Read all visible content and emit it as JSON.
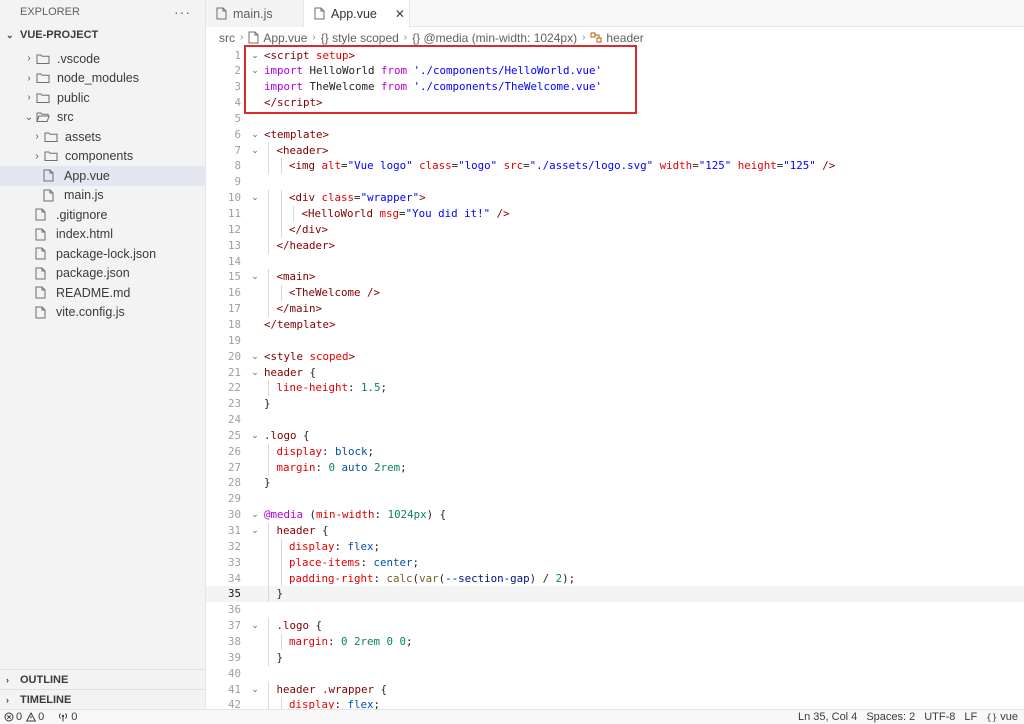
{
  "sidebar": {
    "title": "EXPLORER",
    "more": "···",
    "project": "VUE-PROJECT",
    "tree": [
      {
        "label": ".vscode",
        "type": "folder",
        "depth": 0,
        "open": false
      },
      {
        "label": "node_modules",
        "type": "folder",
        "depth": 0,
        "open": false
      },
      {
        "label": "public",
        "type": "folder",
        "depth": 0,
        "open": false
      },
      {
        "label": "src",
        "type": "folder",
        "depth": 0,
        "open": true
      },
      {
        "label": "assets",
        "type": "folder",
        "depth": 1,
        "open": false
      },
      {
        "label": "components",
        "type": "folder",
        "depth": 1,
        "open": false
      },
      {
        "label": "App.vue",
        "type": "file",
        "depth": 1,
        "selected": true
      },
      {
        "label": "main.js",
        "type": "file",
        "depth": 1
      },
      {
        "label": ".gitignore",
        "type": "file",
        "depth": 0
      },
      {
        "label": "index.html",
        "type": "file",
        "depth": 0
      },
      {
        "label": "package-lock.json",
        "type": "file",
        "depth": 0
      },
      {
        "label": "package.json",
        "type": "file",
        "depth": 0
      },
      {
        "label": "README.md",
        "type": "file",
        "depth": 0
      },
      {
        "label": "vite.config.js",
        "type": "file",
        "depth": 0
      }
    ],
    "outline": "OUTLINE",
    "timeline": "TIMELINE"
  },
  "tabs": [
    {
      "label": "main.js",
      "active": false,
      "icon": "file-icon"
    },
    {
      "label": "App.vue",
      "active": true,
      "icon": "file-icon",
      "close": "✕"
    }
  ],
  "breadcrumb": [
    "src",
    "App.vue",
    "{} style scoped",
    "{} @media (min-width: 1024px)",
    "header"
  ],
  "editor": {
    "current_line": 35,
    "lines": [
      {
        "n": 1,
        "fold": "⌄",
        "indent": 0,
        "tokens": [
          [
            "t-pun",
            "<"
          ],
          [
            "t-tag",
            "script"
          ],
          [
            "t-attr",
            " setup"
          ],
          [
            "t-pun",
            ">"
          ]
        ]
      },
      {
        "n": 2,
        "fold": "⌄",
        "indent": 0,
        "tokens": [
          [
            "t-kw",
            "import"
          ],
          [
            "t-plain",
            " HelloWorld "
          ],
          [
            "t-kw",
            "from"
          ],
          [
            "t-str",
            " './components/HelloWorld.vue'"
          ]
        ]
      },
      {
        "n": 3,
        "fold": "",
        "indent": 0,
        "tokens": [
          [
            "t-kw",
            "import"
          ],
          [
            "t-plain",
            " TheWelcome "
          ],
          [
            "t-kw",
            "from"
          ],
          [
            "t-str",
            " './components/TheWelcome.vue'"
          ]
        ]
      },
      {
        "n": 4,
        "fold": "",
        "indent": 0,
        "tokens": [
          [
            "t-pun",
            "</"
          ],
          [
            "t-tag",
            "script"
          ],
          [
            "t-pun",
            ">"
          ]
        ]
      },
      {
        "n": 5,
        "fold": "",
        "indent": 0,
        "tokens": []
      },
      {
        "n": 6,
        "fold": "⌄",
        "indent": 0,
        "tokens": [
          [
            "t-pun",
            "<"
          ],
          [
            "t-tag",
            "template"
          ],
          [
            "t-pun",
            ">"
          ]
        ]
      },
      {
        "n": 7,
        "fold": "⌄",
        "indent": 1,
        "tokens": [
          [
            "t-pun",
            "<"
          ],
          [
            "t-tag",
            "header"
          ],
          [
            "t-pun",
            ">"
          ]
        ]
      },
      {
        "n": 8,
        "fold": "",
        "indent": 2,
        "tokens": [
          [
            "t-pun",
            "<"
          ],
          [
            "t-tag",
            "img"
          ],
          [
            "t-attr",
            " alt"
          ],
          [
            "t-plain",
            "="
          ],
          [
            "t-str",
            "\"Vue logo\""
          ],
          [
            "t-attr",
            " class"
          ],
          [
            "t-plain",
            "="
          ],
          [
            "t-str",
            "\"logo\""
          ],
          [
            "t-attr",
            " src"
          ],
          [
            "t-plain",
            "="
          ],
          [
            "t-str",
            "\"./assets/logo.svg\""
          ],
          [
            "t-attr",
            " width"
          ],
          [
            "t-plain",
            "="
          ],
          [
            "t-str",
            "\"125\""
          ],
          [
            "t-attr",
            " height"
          ],
          [
            "t-plain",
            "="
          ],
          [
            "t-str",
            "\"125\""
          ],
          [
            "t-pun",
            " />"
          ]
        ]
      },
      {
        "n": 9,
        "fold": "",
        "indent": 0,
        "tokens": []
      },
      {
        "n": 10,
        "fold": "⌄",
        "indent": 2,
        "tokens": [
          [
            "t-pun",
            "<"
          ],
          [
            "t-tag",
            "div"
          ],
          [
            "t-attr",
            " class"
          ],
          [
            "t-plain",
            "="
          ],
          [
            "t-str",
            "\"wrapper\""
          ],
          [
            "t-pun",
            ">"
          ]
        ]
      },
      {
        "n": 11,
        "fold": "",
        "indent": 3,
        "tokens": [
          [
            "t-pun",
            "<"
          ],
          [
            "t-tag",
            "HelloWorld"
          ],
          [
            "t-attr",
            " msg"
          ],
          [
            "t-plain",
            "="
          ],
          [
            "t-str",
            "\"You did it!\""
          ],
          [
            "t-pun",
            " />"
          ]
        ]
      },
      {
        "n": 12,
        "fold": "",
        "indent": 2,
        "tokens": [
          [
            "t-pun",
            "</"
          ],
          [
            "t-tag",
            "div"
          ],
          [
            "t-pun",
            ">"
          ]
        ]
      },
      {
        "n": 13,
        "fold": "",
        "indent": 1,
        "tokens": [
          [
            "t-pun",
            "</"
          ],
          [
            "t-tag",
            "header"
          ],
          [
            "t-pun",
            ">"
          ]
        ]
      },
      {
        "n": 14,
        "fold": "",
        "indent": 0,
        "tokens": []
      },
      {
        "n": 15,
        "fold": "⌄",
        "indent": 1,
        "tokens": [
          [
            "t-pun",
            "<"
          ],
          [
            "t-tag",
            "main"
          ],
          [
            "t-pun",
            ">"
          ]
        ]
      },
      {
        "n": 16,
        "fold": "",
        "indent": 2,
        "tokens": [
          [
            "t-pun",
            "<"
          ],
          [
            "t-tag",
            "TheWelcome"
          ],
          [
            "t-pun",
            " />"
          ]
        ]
      },
      {
        "n": 17,
        "fold": "",
        "indent": 1,
        "tokens": [
          [
            "t-pun",
            "</"
          ],
          [
            "t-tag",
            "main"
          ],
          [
            "t-pun",
            ">"
          ]
        ]
      },
      {
        "n": 18,
        "fold": "",
        "indent": 0,
        "tokens": [
          [
            "t-pun",
            "</"
          ],
          [
            "t-tag",
            "template"
          ],
          [
            "t-pun",
            ">"
          ]
        ]
      },
      {
        "n": 19,
        "fold": "",
        "indent": 0,
        "tokens": []
      },
      {
        "n": 20,
        "fold": "⌄",
        "indent": 0,
        "tokens": [
          [
            "t-pun",
            "<"
          ],
          [
            "t-tag",
            "style"
          ],
          [
            "t-attr",
            " scoped"
          ],
          [
            "t-pun",
            ">"
          ]
        ]
      },
      {
        "n": 21,
        "fold": "⌄",
        "indent": 0,
        "tokens": [
          [
            "t-sel",
            "header"
          ],
          [
            "t-plain",
            " {"
          ]
        ]
      },
      {
        "n": 22,
        "fold": "",
        "indent": 1,
        "tokens": [
          [
            "t-prop",
            "line-height"
          ],
          [
            "t-plain",
            ": "
          ],
          [
            "t-num",
            "1.5"
          ],
          [
            "t-plain",
            ";"
          ]
        ]
      },
      {
        "n": 23,
        "fold": "",
        "indent": 0,
        "tokens": [
          [
            "t-plain",
            "}"
          ]
        ]
      },
      {
        "n": 24,
        "fold": "",
        "indent": 0,
        "tokens": []
      },
      {
        "n": 25,
        "fold": "⌄",
        "indent": 0,
        "tokens": [
          [
            "t-sel",
            ".logo"
          ],
          [
            "t-plain",
            " {"
          ]
        ]
      },
      {
        "n": 26,
        "fold": "",
        "indent": 1,
        "tokens": [
          [
            "t-prop",
            "display"
          ],
          [
            "t-plain",
            ": "
          ],
          [
            "t-val",
            "block"
          ],
          [
            "t-plain",
            ";"
          ]
        ]
      },
      {
        "n": 27,
        "fold": "",
        "indent": 1,
        "tokens": [
          [
            "t-prop",
            "margin"
          ],
          [
            "t-plain",
            ": "
          ],
          [
            "t-num",
            "0"
          ],
          [
            "t-val",
            " auto "
          ],
          [
            "t-num",
            "2rem"
          ],
          [
            "t-plain",
            ";"
          ]
        ]
      },
      {
        "n": 28,
        "fold": "",
        "indent": 0,
        "tokens": [
          [
            "t-plain",
            "}"
          ]
        ]
      },
      {
        "n": 29,
        "fold": "",
        "indent": 0,
        "tokens": []
      },
      {
        "n": 30,
        "fold": "⌄",
        "indent": 0,
        "tokens": [
          [
            "t-kw",
            "@media"
          ],
          [
            "t-plain",
            " ("
          ],
          [
            "t-prop",
            "min-width"
          ],
          [
            "t-plain",
            ": "
          ],
          [
            "t-num",
            "1024px"
          ],
          [
            "t-plain",
            ") {"
          ]
        ]
      },
      {
        "n": 31,
        "fold": "⌄",
        "indent": 1,
        "tokens": [
          [
            "t-sel",
            "header"
          ],
          [
            "t-plain",
            " {"
          ]
        ]
      },
      {
        "n": 32,
        "fold": "",
        "indent": 2,
        "tokens": [
          [
            "t-prop",
            "display"
          ],
          [
            "t-plain",
            ": "
          ],
          [
            "t-val",
            "flex"
          ],
          [
            "t-plain",
            ";"
          ]
        ]
      },
      {
        "n": 33,
        "fold": "",
        "indent": 2,
        "tokens": [
          [
            "t-prop",
            "place-items"
          ],
          [
            "t-plain",
            ": "
          ],
          [
            "t-val",
            "center"
          ],
          [
            "t-plain",
            ";"
          ]
        ]
      },
      {
        "n": 34,
        "fold": "",
        "indent": 2,
        "tokens": [
          [
            "t-prop",
            "padding-right"
          ],
          [
            "t-plain",
            ": "
          ],
          [
            "t-fn",
            "calc"
          ],
          [
            "t-plain",
            "("
          ],
          [
            "t-fn",
            "var"
          ],
          [
            "t-plain",
            "("
          ],
          [
            "t-var",
            "--section-gap"
          ],
          [
            "t-plain",
            ") / "
          ],
          [
            "t-num",
            "2"
          ],
          [
            "t-plain",
            ");"
          ]
        ]
      },
      {
        "n": 35,
        "fold": "",
        "indent": 1,
        "tokens": [
          [
            "t-plain",
            "}"
          ]
        ]
      },
      {
        "n": 36,
        "fold": "",
        "indent": 0,
        "tokens": []
      },
      {
        "n": 37,
        "fold": "⌄",
        "indent": 1,
        "tokens": [
          [
            "t-sel",
            ".logo"
          ],
          [
            "t-plain",
            " {"
          ]
        ]
      },
      {
        "n": 38,
        "fold": "",
        "indent": 2,
        "tokens": [
          [
            "t-prop",
            "margin"
          ],
          [
            "t-plain",
            ": "
          ],
          [
            "t-num",
            "0 2rem 0 0"
          ],
          [
            "t-plain",
            ";"
          ]
        ]
      },
      {
        "n": 39,
        "fold": "",
        "indent": 1,
        "tokens": [
          [
            "t-plain",
            "}"
          ]
        ]
      },
      {
        "n": 40,
        "fold": "",
        "indent": 0,
        "tokens": []
      },
      {
        "n": 41,
        "fold": "⌄",
        "indent": 1,
        "tokens": [
          [
            "t-sel",
            "header .wrapper"
          ],
          [
            "t-plain",
            " {"
          ]
        ]
      },
      {
        "n": 42,
        "fold": "",
        "indent": 2,
        "tokens": [
          [
            "t-prop",
            "display"
          ],
          [
            "t-plain",
            ": "
          ],
          [
            "t-val",
            "flex"
          ],
          [
            "t-plain",
            ";"
          ]
        ]
      }
    ]
  },
  "status": {
    "errors": "0",
    "warnings": "0",
    "ports": "0",
    "position": "Ln 35, Col 4",
    "spaces": "Spaces: 2",
    "encoding": "UTF-8",
    "eol": "LF",
    "language": "vue"
  },
  "colors": {
    "highlight_box": "#d92b2b",
    "folder_icon": "#6e6e6e"
  }
}
